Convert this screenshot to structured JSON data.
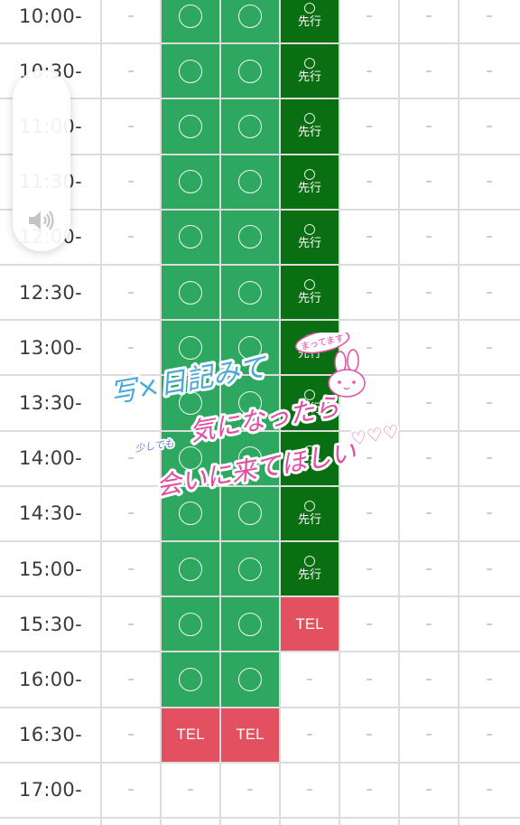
{
  "schedule": {
    "rows": [
      {
        "time": "10:00-",
        "cells": [
          "-",
          "o",
          "o",
          "senkou",
          "-",
          "-",
          "-"
        ]
      },
      {
        "time": "10:30-",
        "cells": [
          "-",
          "o",
          "o",
          "senkou",
          "-",
          "-",
          "-"
        ]
      },
      {
        "time": "11:00-",
        "cells": [
          "-",
          "o",
          "o",
          "senkou",
          "-",
          "-",
          "-"
        ]
      },
      {
        "time": "11:30-",
        "cells": [
          "-",
          "o",
          "o",
          "senkou",
          "-",
          "-",
          "-"
        ]
      },
      {
        "time": "12:00-",
        "cells": [
          "-",
          "o",
          "o",
          "senkou",
          "-",
          "-",
          "-"
        ]
      },
      {
        "time": "12:30-",
        "cells": [
          "-",
          "o",
          "o",
          "senkou",
          "-",
          "-",
          "-"
        ]
      },
      {
        "time": "13:00-",
        "cells": [
          "-",
          "o",
          "o",
          "senkou",
          "-",
          "-",
          "-"
        ]
      },
      {
        "time": "13:30-",
        "cells": [
          "-",
          "o",
          "o",
          "senkou",
          "-",
          "-",
          "-"
        ]
      },
      {
        "time": "14:00-",
        "cells": [
          "-",
          "o",
          "o",
          "senkou",
          "-",
          "-",
          "-"
        ]
      },
      {
        "time": "14:30-",
        "cells": [
          "-",
          "o",
          "o",
          "senkou",
          "-",
          "-",
          "-"
        ]
      },
      {
        "time": "15:00-",
        "cells": [
          "-",
          "o",
          "o",
          "senkou",
          "-",
          "-",
          "-"
        ]
      },
      {
        "time": "15:30-",
        "cells": [
          "-",
          "o",
          "o",
          "tel",
          "-",
          "-",
          "-"
        ]
      },
      {
        "time": "16:00-",
        "cells": [
          "-",
          "o",
          "o",
          "-",
          "-",
          "-",
          "-"
        ]
      },
      {
        "time": "16:30-",
        "cells": [
          "-",
          "tel",
          "tel",
          "-",
          "-",
          "-",
          "-"
        ]
      },
      {
        "time": "17:00-",
        "cells": [
          "-",
          "-",
          "-",
          "-",
          "-",
          "-",
          "-"
        ]
      }
    ],
    "labels": {
      "dash": "–",
      "senkou": "先行",
      "tel": "TEL"
    },
    "colors": {
      "available": "#2ea760",
      "advance": "#0a6e12",
      "tel": "#e3505f",
      "grid": "#dcdcdc"
    }
  },
  "volume": {
    "icon": "speaker-volume-icon"
  },
  "sticker": {
    "line1": "写×日記みて",
    "line2": "気になったら",
    "line3": "会いに来てほしい",
    "small_left": "少しでも",
    "badge": "まってます",
    "hearts": "♡♡♡",
    "icon": "bunny-icon"
  }
}
